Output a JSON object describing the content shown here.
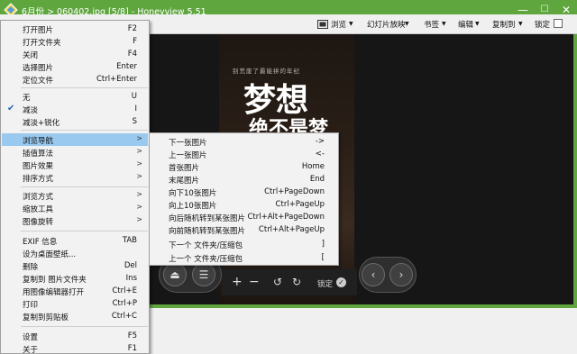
{
  "window": {
    "title": "6月份 > 060402.jpg [5/8] - Honeyview 5.51",
    "controls": {
      "minimize": "—",
      "maximize": "☐",
      "close": "✕"
    },
    "accent_color": "#5fa63f"
  },
  "toolbar": {
    "items": [
      "浏览",
      "幻灯片放映",
      "书签",
      "编辑",
      "复制到",
      "锁定"
    ]
  },
  "image": {
    "subtitle": "别荒废了最能拼的年纪",
    "title_line1": "梦想",
    "title_line2": "绝不是梦"
  },
  "controls": {
    "lock_label": "锁定"
  },
  "main_menu": {
    "items": [
      {
        "label": "打开图片",
        "shortcut": "F2"
      },
      {
        "label": "打开文件夹",
        "shortcut": "F"
      },
      {
        "label": "关闭",
        "shortcut": "F4"
      },
      {
        "label": "选择图片",
        "shortcut": "Enter"
      },
      {
        "label": "定位文件",
        "shortcut": "Ctrl+Enter"
      },
      {
        "label": "无",
        "shortcut": "U"
      },
      {
        "label": "减淡",
        "shortcut": "I"
      },
      {
        "label": "减淡+锐化",
        "shortcut": "S"
      },
      {
        "label": "浏览导航",
        "shortcut": ""
      },
      {
        "label": "插值算法",
        "shortcut": ""
      },
      {
        "label": "图片效果",
        "shortcut": ""
      },
      {
        "label": "排序方式",
        "shortcut": ""
      },
      {
        "label": "浏览方式",
        "shortcut": ""
      },
      {
        "label": "缩放工具",
        "shortcut": ""
      },
      {
        "label": "图像旋转",
        "shortcut": ""
      },
      {
        "label": "EXIF 信息",
        "shortcut": "TAB"
      },
      {
        "label": "设为桌面壁纸...",
        "shortcut": ""
      },
      {
        "label": "删除",
        "shortcut": "Del"
      },
      {
        "label": "复制到 图片文件夹",
        "shortcut": "Ins"
      },
      {
        "label": "用图像编辑器打开",
        "shortcut": "Ctrl+E"
      },
      {
        "label": "打印",
        "shortcut": "Ctrl+P"
      },
      {
        "label": "复制到剪贴板",
        "shortcut": "Ctrl+C"
      },
      {
        "label": "设置",
        "shortcut": "F5"
      },
      {
        "label": "关于",
        "shortcut": "F1"
      }
    ]
  },
  "nav_submenu": {
    "items": [
      {
        "label": "下一张图片",
        "shortcut": "->"
      },
      {
        "label": "上一张图片",
        "shortcut": "<-"
      },
      {
        "label": "首张图片",
        "shortcut": "Home"
      },
      {
        "label": "末尾图片",
        "shortcut": "End"
      },
      {
        "label": "向下10张图片",
        "shortcut": "Ctrl+PageDown"
      },
      {
        "label": "向上10张图片",
        "shortcut": "Ctrl+PageUp"
      },
      {
        "label": "向后随机转到某张图片",
        "shortcut": "Ctrl+Alt+PageDown"
      },
      {
        "label": "向前随机转到某张图片",
        "shortcut": "Ctrl+Alt+PageUp"
      },
      {
        "label": "下一个 文件夹/压缩包",
        "shortcut": "]"
      },
      {
        "label": "上一个 文件夹/压缩包",
        "shortcut": "["
      }
    ]
  }
}
